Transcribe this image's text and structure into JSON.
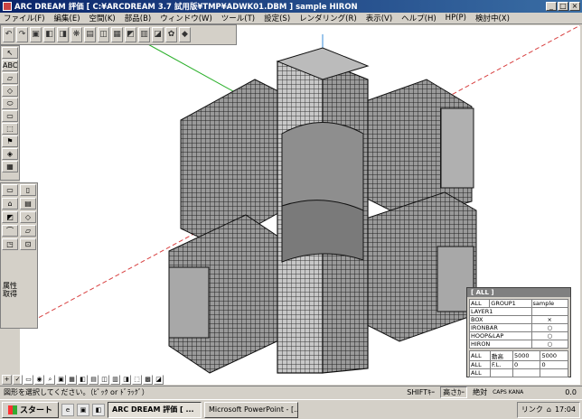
{
  "window": {
    "title": "ARC DREAM 評価 [ C:¥ARCDREAM 3.7 試用版¥TMP¥ADWK01.DBM ] sample HIRON",
    "controls": [
      "_",
      "□",
      "×"
    ]
  },
  "menu": [
    "ファイル(F)",
    "編集(E)",
    "空間(K)",
    "部品(B)",
    "ウィンドウ(W)",
    "ツール(T)",
    "設定(S)",
    "レンダリング(R)",
    "表示(V)",
    "ヘルプ(H)",
    "HP(P)",
    "検討中(X)"
  ],
  "top_toolbar": [
    "↶",
    "↷",
    "▣",
    "◧",
    "◨",
    "❋",
    "▤",
    "◫",
    "▦",
    "◩",
    "▥",
    "◪",
    "✿",
    "◆"
  ],
  "left_toolbar_1": [
    "↖",
    "ABC",
    "▱",
    "◇",
    "⬭",
    "▭",
    "⬚",
    "⚑",
    "◈",
    "▦"
  ],
  "left_toolbar_2": [
    "▭",
    "▯",
    "⌂",
    "▤",
    "◩",
    "◇",
    "⌒",
    "▱",
    "◳",
    "⊡"
  ],
  "left_attr_label": "属性\n取得",
  "bottom_toolbar": [
    "+",
    "✓",
    "▭",
    "◉",
    "⌕",
    "▣",
    "▦",
    "◧",
    "▤",
    "◫",
    "▥",
    "◨",
    "⬚",
    "▩",
    "◪"
  ],
  "layer_panel": {
    "title": "[ ALL ]",
    "header": [
      "ALL",
      "GROUP1",
      "sample"
    ],
    "rows": [
      {
        "name": "LAYER1",
        "mark": ""
      },
      {
        "name": "BOX",
        "mark": "×"
      },
      {
        "name": "IRONBAR",
        "mark": "○"
      },
      {
        "name": "HOOP&LAP",
        "mark": "○"
      },
      {
        "name": "HIRON",
        "mark": "○"
      }
    ],
    "footer": [
      [
        "ALL",
        "動高",
        "5000",
        "5000"
      ],
      [
        "ALL",
        "F.L.",
        "0",
        "0"
      ],
      [
        "ALL",
        "",
        "",
        ""
      ]
    ]
  },
  "status": {
    "message": "図形を選択してください。（ﾋﾟｯｸ or ﾄﾞﾗｯｸﾞ）",
    "shift": "SHIFTｷｰ",
    "height": "高さｶｰ",
    "abs": "絶対",
    "coord": "0.0",
    "caps": "CAPS KANA"
  },
  "taskbar": {
    "start": "スタート",
    "tasks": [
      {
        "label": "ARC DREAM 評価 [ ...",
        "active": true
      },
      {
        "label": "Microsoft PowerPoint - [...",
        "active": false
      }
    ],
    "tray_link": "リンク",
    "time": "17:04"
  },
  "colors": {
    "title_bar": "#0a246a",
    "axis_green": "#2bb02b",
    "axis_blue": "#5aa0e0",
    "axis_red": "#d84040",
    "rebar": "#3a3a3a"
  }
}
